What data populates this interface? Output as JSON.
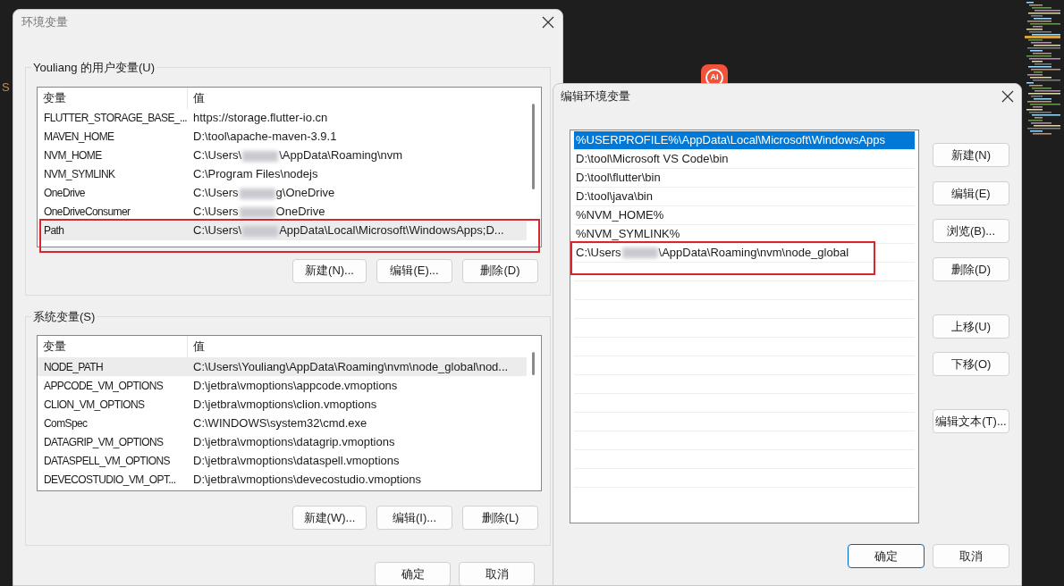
{
  "background_fragment": "S",
  "env_dialog": {
    "title": "环境变量",
    "user_group": {
      "label": "Youliang 的用户变量(U)",
      "columns": [
        "变量",
        "值"
      ],
      "rows": [
        {
          "name": "FLUTTER_STORAGE_BASE_...",
          "value_parts": [
            "https://storage.flutter-io.cn"
          ],
          "selected": false,
          "highlighted": false
        },
        {
          "name": "MAVEN_HOME",
          "value_parts": [
            "D:\\tool\\apache-maven-3.9.1"
          ],
          "selected": false,
          "highlighted": false
        },
        {
          "name": "NVM_HOME",
          "value_parts": [
            "C:\\Users\\",
            "\\AppData\\Roaming\\nvm"
          ],
          "selected": false,
          "highlighted": false
        },
        {
          "name": "NVM_SYMLINK",
          "value_parts": [
            "C:\\Program Files\\nodejs"
          ],
          "selected": false,
          "highlighted": false
        },
        {
          "name": "OneDrive",
          "value_parts": [
            "C:\\Users",
            "g\\OneDrive"
          ],
          "selected": false,
          "highlighted": false
        },
        {
          "name": "OneDriveConsumer",
          "value_parts": [
            "C:\\Users",
            "OneDrive"
          ],
          "selected": false,
          "highlighted": false
        },
        {
          "name": "Path",
          "value_parts": [
            "C:\\Users\\",
            "AppData\\Local\\Microsoft\\WindowsApps;D..."
          ],
          "selected": true,
          "highlighted": true
        }
      ],
      "buttons": [
        "新建(N)...",
        "编辑(E)...",
        "删除(D)"
      ]
    },
    "system_group": {
      "label": "系统变量(S)",
      "columns": [
        "变量",
        "值"
      ],
      "rows": [
        {
          "name": "NODE_PATH",
          "value_parts": [
            "C:\\Users\\Youliang\\AppData\\Roaming\\nvm\\node_global\\nod..."
          ],
          "selected": true,
          "highlighted": false
        },
        {
          "name": "APPCODE_VM_OPTIONS",
          "value_parts": [
            "D:\\jetbra\\vmoptions\\appcode.vmoptions"
          ],
          "selected": false,
          "highlighted": false
        },
        {
          "name": "CLION_VM_OPTIONS",
          "value_parts": [
            "D:\\jetbra\\vmoptions\\clion.vmoptions"
          ],
          "selected": false,
          "highlighted": false
        },
        {
          "name": "ComSpec",
          "value_parts": [
            "C:\\WINDOWS\\system32\\cmd.exe"
          ],
          "selected": false,
          "highlighted": false
        },
        {
          "name": "DATAGRIP_VM_OPTIONS",
          "value_parts": [
            "D:\\jetbra\\vmoptions\\datagrip.vmoptions"
          ],
          "selected": false,
          "highlighted": false
        },
        {
          "name": "DATASPELL_VM_OPTIONS",
          "value_parts": [
            "D:\\jetbra\\vmoptions\\dataspell.vmoptions"
          ],
          "selected": false,
          "highlighted": false
        },
        {
          "name": "DEVECOSTUDIO_VM_OPT...",
          "value_parts": [
            "D:\\jetbra\\vmoptions\\devecostudio.vmoptions"
          ],
          "selected": false,
          "highlighted": false
        }
      ],
      "buttons": [
        "新建(W)...",
        "编辑(I)...",
        "删除(L)"
      ]
    },
    "footer_buttons": [
      {
        "label": "确定",
        "default": false
      },
      {
        "label": "取消",
        "default": false
      }
    ]
  },
  "ai_badge": {
    "label": "AI"
  },
  "edit_dialog": {
    "title": "编辑环境变量",
    "entries": [
      {
        "value_parts": [
          "%USERPROFILE%\\AppData\\Local\\Microsoft\\WindowsApps"
        ],
        "selected": true,
        "highlighted": false
      },
      {
        "value_parts": [
          "D:\\tool\\Microsoft VS Code\\bin"
        ],
        "selected": false,
        "highlighted": false
      },
      {
        "value_parts": [
          "D:\\tool\\flutter\\bin"
        ],
        "selected": false,
        "highlighted": false
      },
      {
        "value_parts": [
          "D:\\tool\\java\\bin"
        ],
        "selected": false,
        "highlighted": false
      },
      {
        "value_parts": [
          "%NVM_HOME%"
        ],
        "selected": false,
        "highlighted": false
      },
      {
        "value_parts": [
          "%NVM_SYMLINK%"
        ],
        "selected": false,
        "highlighted": false
      },
      {
        "value_parts": [
          "C:\\Users",
          "\\AppData\\Roaming\\nvm\\node_global"
        ],
        "selected": false,
        "highlighted": true
      }
    ],
    "side_buttons": [
      "新建(N)",
      "编辑(E)",
      "浏览(B)...",
      "删除(D)",
      "上移(U)",
      "下移(O)",
      "编辑文本(T)..."
    ],
    "footer_buttons": [
      {
        "label": "确定",
        "default": true
      },
      {
        "label": "取消",
        "default": false
      }
    ]
  }
}
